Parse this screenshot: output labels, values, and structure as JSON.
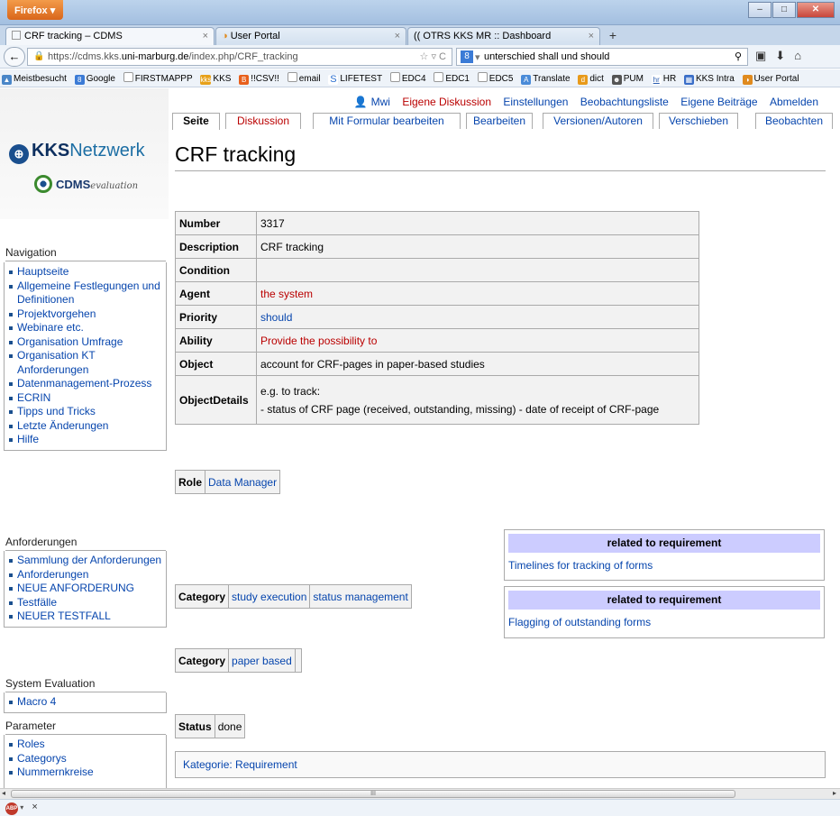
{
  "browser": {
    "app_button": "Firefox",
    "tabs": [
      {
        "label": "CRF tracking – CDMS"
      },
      {
        "label": "User Portal"
      },
      {
        "label": "(( OTRS KKS MR :: Dashboard"
      }
    ],
    "new_tab": "+",
    "url_prefix": "https://cdms.kks.",
    "url_domain": "uni-marburg.de",
    "url_suffix": "/index.php/CRF_tracking",
    "search_value": "unterschied shall und should",
    "bookmarks": [
      "Meistbesucht",
      "Google",
      "FIRSTMAPPP",
      "KKS",
      "!!CSV!!",
      "email",
      "LIFETEST",
      "EDC4",
      "EDC1",
      "EDC5",
      "Translate",
      "dict",
      "PUM",
      "HR",
      "KKS Intra",
      "User Portal"
    ]
  },
  "personal": {
    "user": "Mwi",
    "links": [
      "Eigene Diskussion",
      "Einstellungen",
      "Beobachtungsliste",
      "Eigene Beiträge",
      "Abmelden"
    ]
  },
  "content_tabs": [
    "Seite",
    "Diskussion",
    "Mit Formular bearbeiten",
    "Bearbeiten",
    "Versionen/Autoren",
    "Verschieben",
    "Beobachten"
  ],
  "logo": {
    "kks": "KKS",
    "netzwerk": "Netzwerk",
    "cdms": "CDMS",
    "evaluation": "evaluation"
  },
  "sidebar": {
    "navigation": {
      "title": "Navigation",
      "items": [
        "Hauptseite",
        "Allgemeine Festlegungen und Definitionen",
        "Projektvorgehen",
        "Webinare etc.",
        "Organisation Umfrage",
        "Organisation KT Anforderungen",
        "Datenmanagement-Prozess",
        "ECRIN",
        "Tipps und Tricks",
        "Letzte Änderungen",
        "Hilfe"
      ]
    },
    "anforderungen": {
      "title": "Anforderungen",
      "items": [
        "Sammlung der Anforderungen",
        "Anforderungen",
        "NEUE ANFORDERUNG",
        "Testfälle",
        "NEUER TESTFALL"
      ]
    },
    "system_evaluation": {
      "title": "System Evaluation",
      "items": [
        "Macro 4"
      ]
    },
    "parameter": {
      "title": "Parameter",
      "items": [
        "Roles",
        "Categorys",
        "Nummernkreise"
      ]
    }
  },
  "page": {
    "title": "CRF tracking",
    "properties": [
      {
        "key": "Number",
        "value": "3317"
      },
      {
        "key": "Description",
        "value": "CRF tracking"
      },
      {
        "key": "Condition",
        "value": ""
      },
      {
        "key": "Agent",
        "value": "the system"
      },
      {
        "key": "Priority",
        "value": "should"
      },
      {
        "key": "Ability",
        "value": "Provide the possibility to"
      },
      {
        "key": "Object",
        "value": "account for CRF-pages in paper-based studies"
      }
    ],
    "object_details": {
      "key": "ObjectDetails",
      "line1": "e.g. to track:",
      "line2": "- status of CRF page (received, outstanding, missing) - date of receipt of CRF-page"
    },
    "role": {
      "key": "Role",
      "value": "Data Manager"
    },
    "category1": {
      "key": "Category",
      "values": [
        "study execution",
        "status management"
      ]
    },
    "category2": {
      "key": "Category",
      "value": "paper based"
    },
    "status": {
      "key": "Status",
      "value": "done"
    },
    "related": [
      {
        "header": "related to requirement",
        "link": "Timelines for tracking of forms"
      },
      {
        "header": "related to requirement",
        "link": "Flagging of outstanding forms"
      }
    ],
    "catlinks": "Kategorie: Requirement"
  },
  "statusbar": {
    "close": "×",
    "scroll_grip": "III"
  }
}
